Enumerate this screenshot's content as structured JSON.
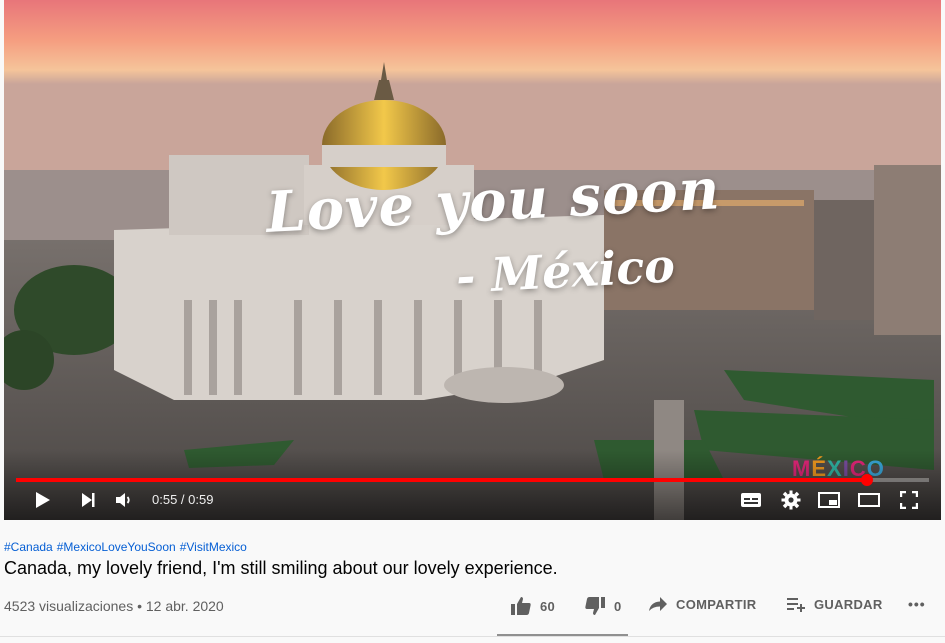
{
  "video": {
    "overlay_title": "Love you soon",
    "overlay_subtitle": "- México",
    "watermark": [
      "M",
      "É",
      "X",
      "I",
      "C",
      "O"
    ],
    "current_time": "0:55",
    "duration": "0:59",
    "time_display": "0:55 / 0:59",
    "progress_fraction": 0.932
  },
  "icons": {
    "play": "play-icon",
    "next": "next-icon",
    "volume": "volume-icon",
    "captions": "subtitles-icon",
    "settings": "gear-icon",
    "miniplayer": "miniplayer-icon",
    "theater": "theater-icon",
    "fullscreen": "fullscreen-icon"
  },
  "info": {
    "hashtags": [
      "#Canada",
      "#MexicoLoveYouSoon",
      "#VisitMexico"
    ],
    "title": "Canada, my lovely friend, I'm still smiling about our lovely experience.",
    "views": "4523 visualizaciones",
    "date": "12 abr. 2020",
    "views_line": "4523 visualizaciones • 12 abr. 2020"
  },
  "actions": {
    "likes": "60",
    "dislikes": "0",
    "share_label": "COMPARTIR",
    "save_label": "GUARDAR",
    "more_label": "•••"
  },
  "colors": {
    "progress": "#ff0000",
    "link": "#065fd4",
    "text": "#030303",
    "muted": "#606060"
  }
}
